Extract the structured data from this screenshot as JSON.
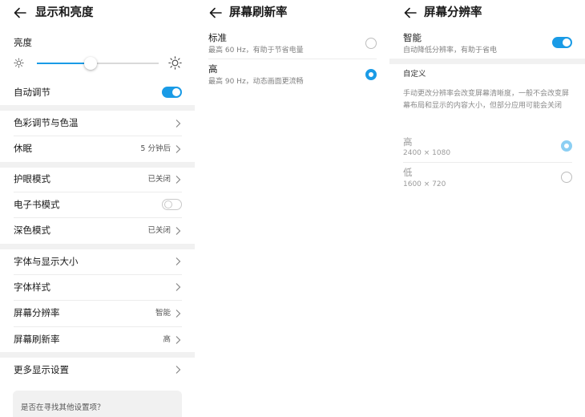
{
  "panel_display": {
    "title": "显示和亮度",
    "brightness_label": "亮度",
    "brightness_level": 0.44,
    "auto_adjust_label": "自动调节",
    "auto_adjust_on": true,
    "items": [
      {
        "label": "色彩调节与色温",
        "value": ""
      },
      {
        "label": "休眠",
        "value": "5 分钟后"
      },
      {
        "label": "护眼模式",
        "value": "已关闭"
      },
      {
        "label": "电子书模式",
        "value": ""
      },
      {
        "label": "深色模式",
        "value": "已关闭"
      },
      {
        "label": "字体与显示大小",
        "value": ""
      },
      {
        "label": "字体样式",
        "value": ""
      },
      {
        "label": "屏幕分辨率",
        "value": "智能"
      },
      {
        "label": "屏幕刷新率",
        "value": "高"
      },
      {
        "label": "更多显示设置",
        "value": ""
      }
    ],
    "ebook_mode_on": false,
    "search_card_text": "是否在寻找其他设置项？"
  },
  "panel_refresh": {
    "title": "屏幕刷新率",
    "options": [
      {
        "label": "标准",
        "desc": "最高 60 Hz，有助于节省电量",
        "selected": false
      },
      {
        "label": "高",
        "desc": "最高 90 Hz，动态画面更流畅",
        "selected": true
      }
    ]
  },
  "panel_resolution": {
    "title": "屏幕分辨率",
    "smart_label": "智能",
    "smart_desc": "自动降低分辨率，有助于省电",
    "smart_on": true,
    "custom_header": "自定义",
    "custom_desc": "手动更改分辨率会改变屏幕清晰度，一般不会改变屏幕布局和显示的内容大小，但部分应用可能会关闭",
    "options": [
      {
        "label": "高",
        "value": "2400 × 1080",
        "selected": true
      },
      {
        "label": "低",
        "value": "1600 × 720",
        "selected": false
      }
    ]
  },
  "colors": {
    "accent": "#1a9be6",
    "divider": "#ececec",
    "section_gap": "#f1f1f1"
  }
}
